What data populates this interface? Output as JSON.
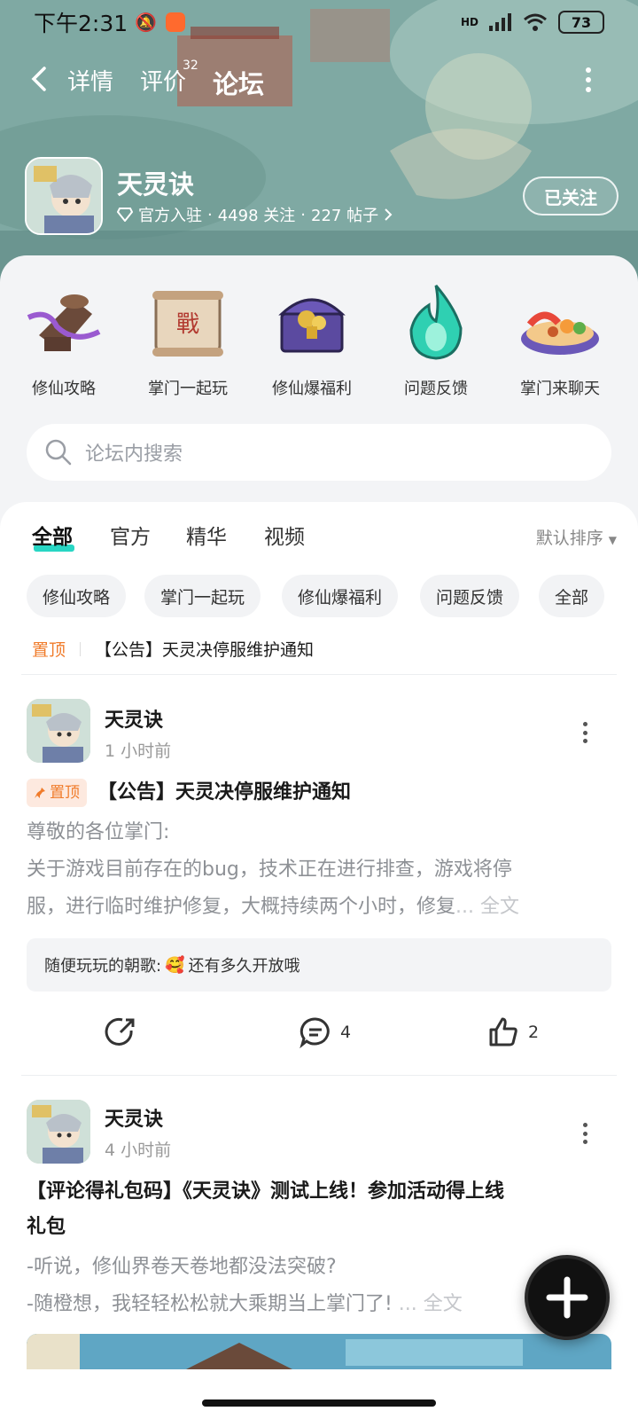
{
  "status_bar": {
    "time": "下午2:31",
    "battery": "73",
    "network": "HD"
  },
  "nav": {
    "tabs": [
      {
        "label": "详情"
      },
      {
        "label": "评价",
        "badge": "32"
      },
      {
        "label": "论坛"
      }
    ],
    "active_tab": "论坛"
  },
  "game": {
    "title": "天灵诀",
    "meta_official": "官方入驻",
    "meta_followers": "4498 关注",
    "meta_posts": "227 帖子",
    "follow_button": "已关注"
  },
  "categories": [
    {
      "label": "修仙攻略",
      "icon": "bell-chain-icon"
    },
    {
      "label": "掌门一起玩",
      "icon": "scroll-icon"
    },
    {
      "label": "修仙爆福利",
      "icon": "treasure-chest-icon"
    },
    {
      "label": "问题反馈",
      "icon": "green-flame-icon"
    },
    {
      "label": "掌门来聊天",
      "icon": "food-plate-icon"
    }
  ],
  "search": {
    "placeholder": "论坛内搜索"
  },
  "feed_tabs": [
    {
      "label": "全部"
    },
    {
      "label": "官方"
    },
    {
      "label": "精华"
    },
    {
      "label": "视频"
    }
  ],
  "sort_label": "默认排序",
  "chips": [
    "修仙攻略",
    "掌门一起玩",
    "修仙爆福利",
    "问题反馈",
    "全部"
  ],
  "pinned": {
    "tag": "置顶",
    "title": "【公告】天灵决停服维护通知"
  },
  "posts": [
    {
      "author": "天灵诀",
      "time": "1 小时前",
      "pin_badge": "置顶",
      "title": "【公告】天灵决停服维护通知",
      "body_line1": "尊敬的各位掌门:",
      "body_line2": "关于游戏目前存在的bug，技术正在进行排查，游戏将停",
      "body_line3": "服，进行临时维护修复，大概持续两个小时，修复",
      "more": "... 全文",
      "comment_user": "随便玩玩的朝歌:",
      "comment_text": "还有多久开放哦",
      "comments": "4",
      "likes": "2"
    },
    {
      "author": "天灵诀",
      "time": "4 小时前",
      "title_line1": "【评论得礼包码】《天灵诀》测试上线！参加活动得上线",
      "title_line2": "礼包",
      "body_line1": "-听说，修仙界卷天卷地都没法突破?",
      "body_line2": "-随橙想，我轻轻松松就大乘期当上掌门了!",
      "more": "... 全文"
    }
  ],
  "colors": {
    "accent": "#28d6c4",
    "pin": "#f07b2a"
  }
}
